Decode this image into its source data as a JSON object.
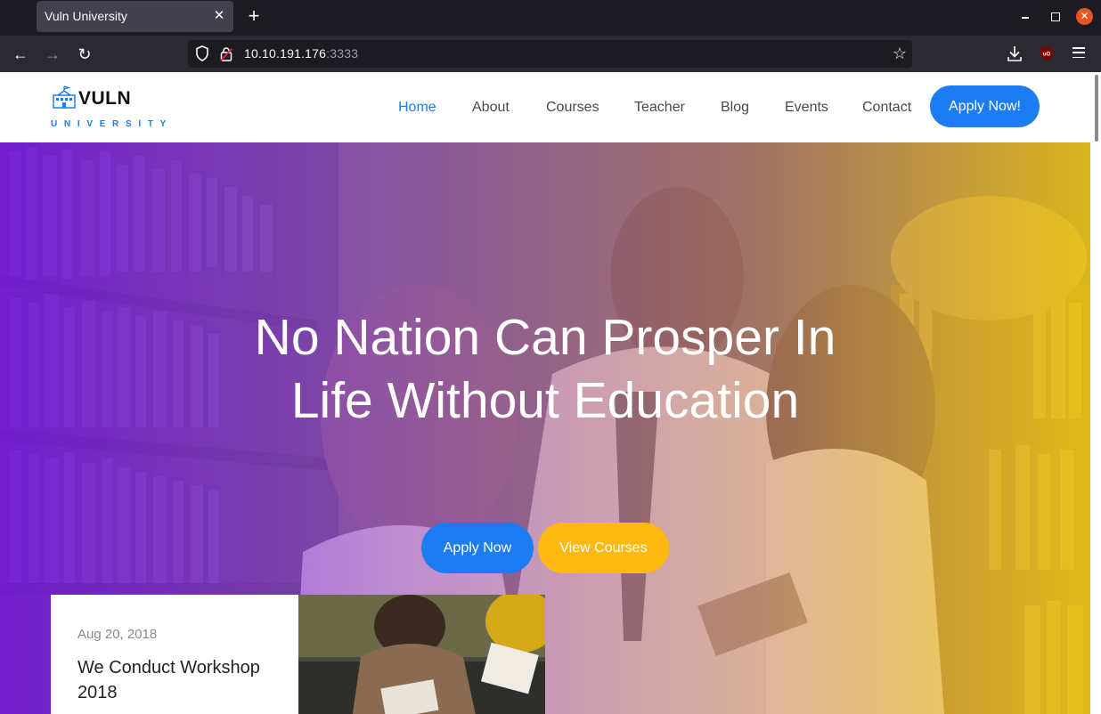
{
  "browser": {
    "tab_title": "Vuln University",
    "tab_close": "✕",
    "new_tab": "+",
    "url_host": "10.10.191.176",
    "url_port": ":3333"
  },
  "site": {
    "logo_name": "VULN",
    "logo_sub": "UNIVERSITY",
    "nav": [
      "Home",
      "About",
      "Courses",
      "Teacher",
      "Blog",
      "Events",
      "Contact"
    ],
    "active_nav": "Home",
    "header_cta": "Apply Now!"
  },
  "hero": {
    "title_line1": "No Nation Can Prosper In",
    "title_line2": "Life Without Education",
    "apply_button": "Apply Now",
    "courses_button": "View Courses"
  },
  "event": {
    "date": "Aug 20, 2018",
    "title": "We Conduct Workshop 2018"
  },
  "colors": {
    "accent_blue": "#1d7cf2",
    "accent_yellow": "#fdb910",
    "hero_gradient_start": "#7e1beb",
    "hero_gradient_end": "#f6cd12",
    "browser_bg": "#1c1b22"
  },
  "icons": [
    "shield-icon",
    "lock-icon",
    "star-icon",
    "download-icon",
    "ublock-icon",
    "menu-icon",
    "back-icon",
    "forward-icon",
    "reload-icon",
    "school-icon"
  ]
}
